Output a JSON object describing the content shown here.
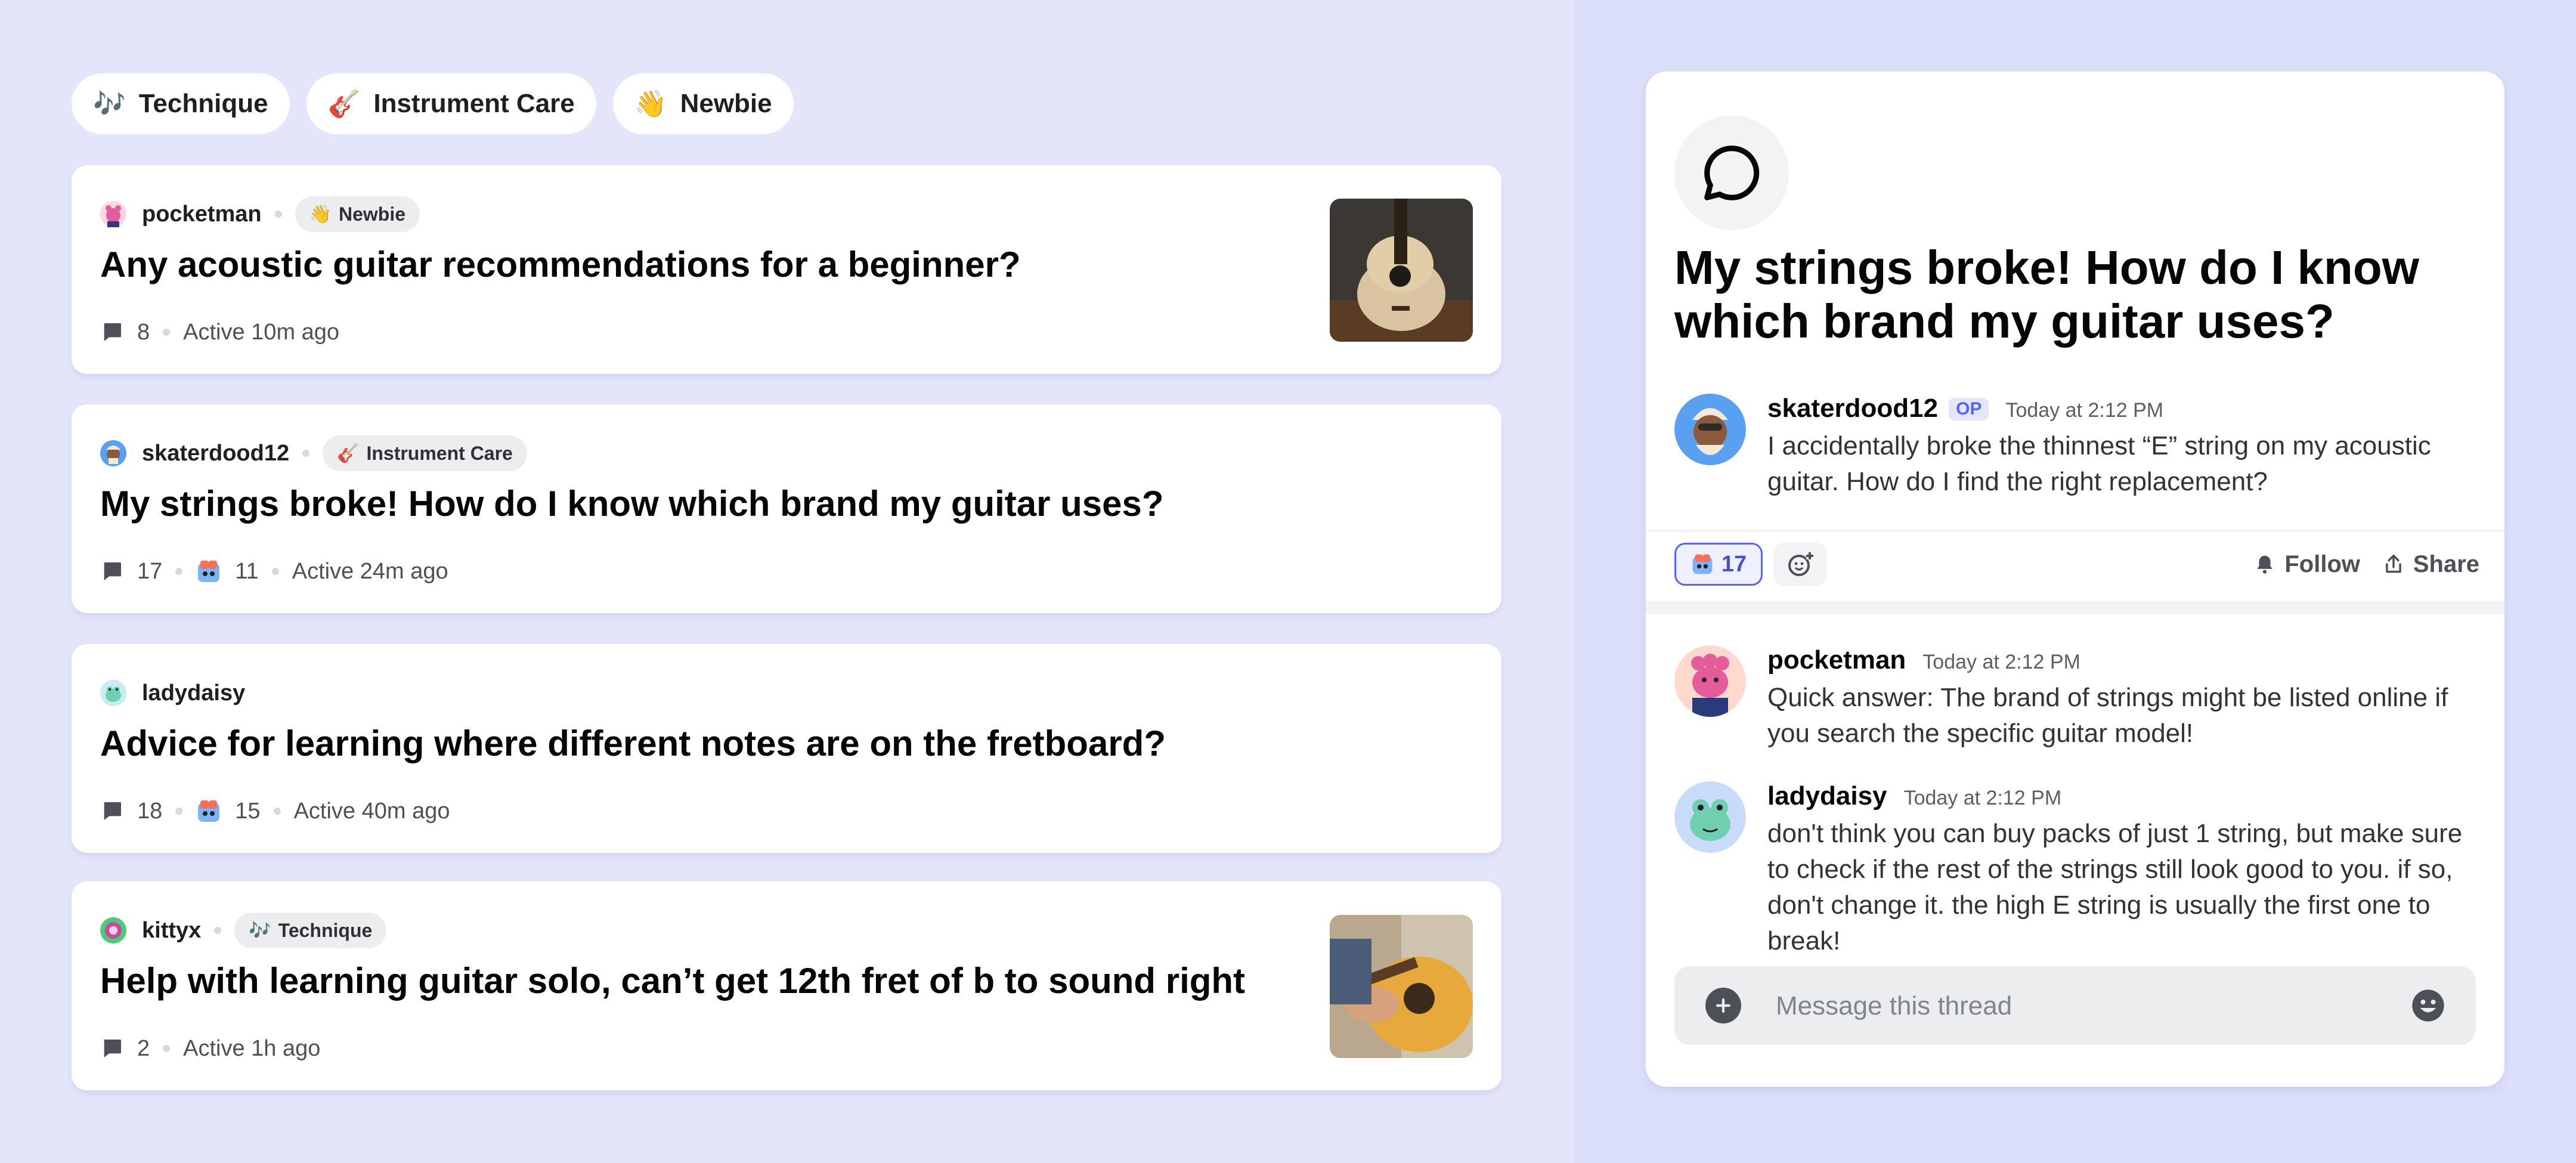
{
  "filter_tags": [
    {
      "emoji": "🎶",
      "label": "Technique"
    },
    {
      "emoji": "🎸",
      "label": "Instrument Care"
    },
    {
      "emoji": "👋",
      "label": "Newbie"
    }
  ],
  "posts": [
    {
      "author": "pocketman",
      "tag": {
        "emoji": "👋",
        "label": "Newbie"
      },
      "title": "Any acoustic guitar recommendations for a beginner?",
      "comments": "8",
      "active": "Active 10m ago",
      "thumbnail": "acoustic-guitar"
    },
    {
      "author": "skaterdood12",
      "tag": {
        "emoji": "🎸",
        "label": "Instrument Care"
      },
      "title": "My strings broke! How do I know which brand my guitar uses?",
      "comments": "17",
      "reactions": "11",
      "active": "Active 24m ago"
    },
    {
      "author": "ladydaisy",
      "title": "Advice for learning where different notes are on the fretboard?",
      "comments": "18",
      "reactions": "15",
      "active": "Active 40m ago"
    },
    {
      "author": "kittyx",
      "tag": {
        "emoji": "🎶",
        "label": "Technique"
      },
      "title": "Help with learning guitar solo, can’t get 12th fret of b to sound right",
      "comments": "2",
      "active": "Active 1h ago",
      "thumbnail": "guitar-player"
    }
  ],
  "thread": {
    "title": "My strings broke! How do I know which brand my guitar uses?",
    "op": {
      "author": "skaterdood12",
      "badge": "OP",
      "time": "Today at 2:12 PM",
      "body": "I accidentally broke the thinnest “E” string on my acoustic guitar. How do I find the right replacement?"
    },
    "reaction_count": "17",
    "follow_label": "Follow",
    "share_label": "Share",
    "replies": [
      {
        "author": "pocketman",
        "time": "Today at 2:12 PM",
        "body": "Quick answer: The brand of strings might be listed online if you search the specific guitar model!"
      },
      {
        "author": "ladydaisy",
        "time": "Today at 2:12 PM",
        "body": "don't think you can buy packs of just 1 string, but make sure to check if the rest of the strings still look good to you. if so, don't change it. the high E string is usually the first one to break!"
      }
    ],
    "composer_placeholder": "Message this thread"
  },
  "colors": {
    "accent": "#5865f2",
    "left_bg": "#e3e6fb",
    "right_bg": "#dcdffa"
  }
}
